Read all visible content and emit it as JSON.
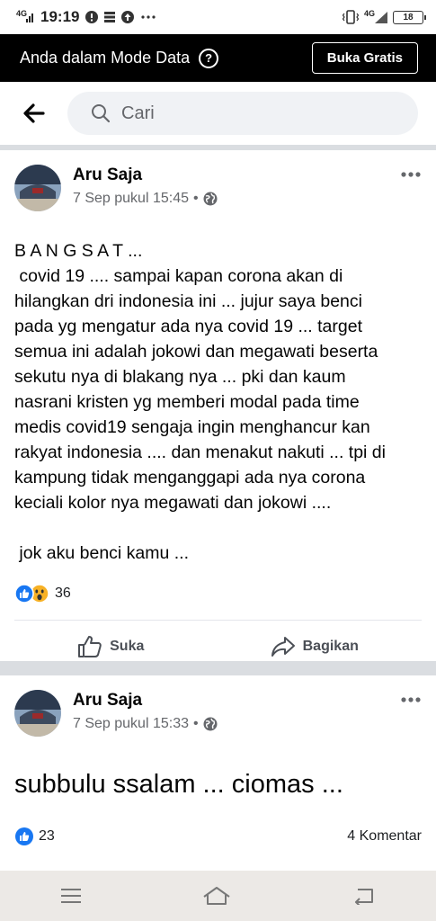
{
  "status_bar": {
    "signal_label": "4G",
    "time": "19:19",
    "network_label": "4G",
    "battery": "18"
  },
  "banner": {
    "text": "Anda dalam Mode Data",
    "button_label": "Buka Gratis"
  },
  "search": {
    "placeholder": "Cari"
  },
  "posts": [
    {
      "author": "Aru Saja",
      "timestamp": "7 Sep pukul 15:45",
      "privacy_separator": "•",
      "text": "B A N G S A T ...\n covid 19 .... sampai kapan corona akan di\nhilangkan dri indonesia ini ... jujur saya benci\npada yg mengatur ada nya covid 19 ... target\nsemua ini adalah jokowi dan megawati beserta\nsekutu nya di blakang nya ... pki dan kaum\nnasrani kristen yg memberi modal pada time\nmedis covid19 sengaja ingin menghancur kan\nrakyat indonesia .... dan menakut nakuti ... tpi di\nkampung tidak menganggapi ada nya corona\nkeciali kolor nya megawati dan jokowi ....\n\n jok aku benci kamu ...",
      "reaction_count": "36",
      "like_label": "Suka",
      "share_label": "Bagikan"
    },
    {
      "author": "Aru Saja",
      "timestamp": "7 Sep pukul 15:33",
      "privacy_separator": "•",
      "text": "subbulu ssalam ... ciomas ...",
      "reaction_count": "23",
      "comments_label": "4 Komentar"
    }
  ],
  "colors": {
    "banner_bg": "#000000",
    "like_blue": "#1877f2",
    "divider": "#dadde1",
    "nav_bg": "#ece9e6"
  }
}
